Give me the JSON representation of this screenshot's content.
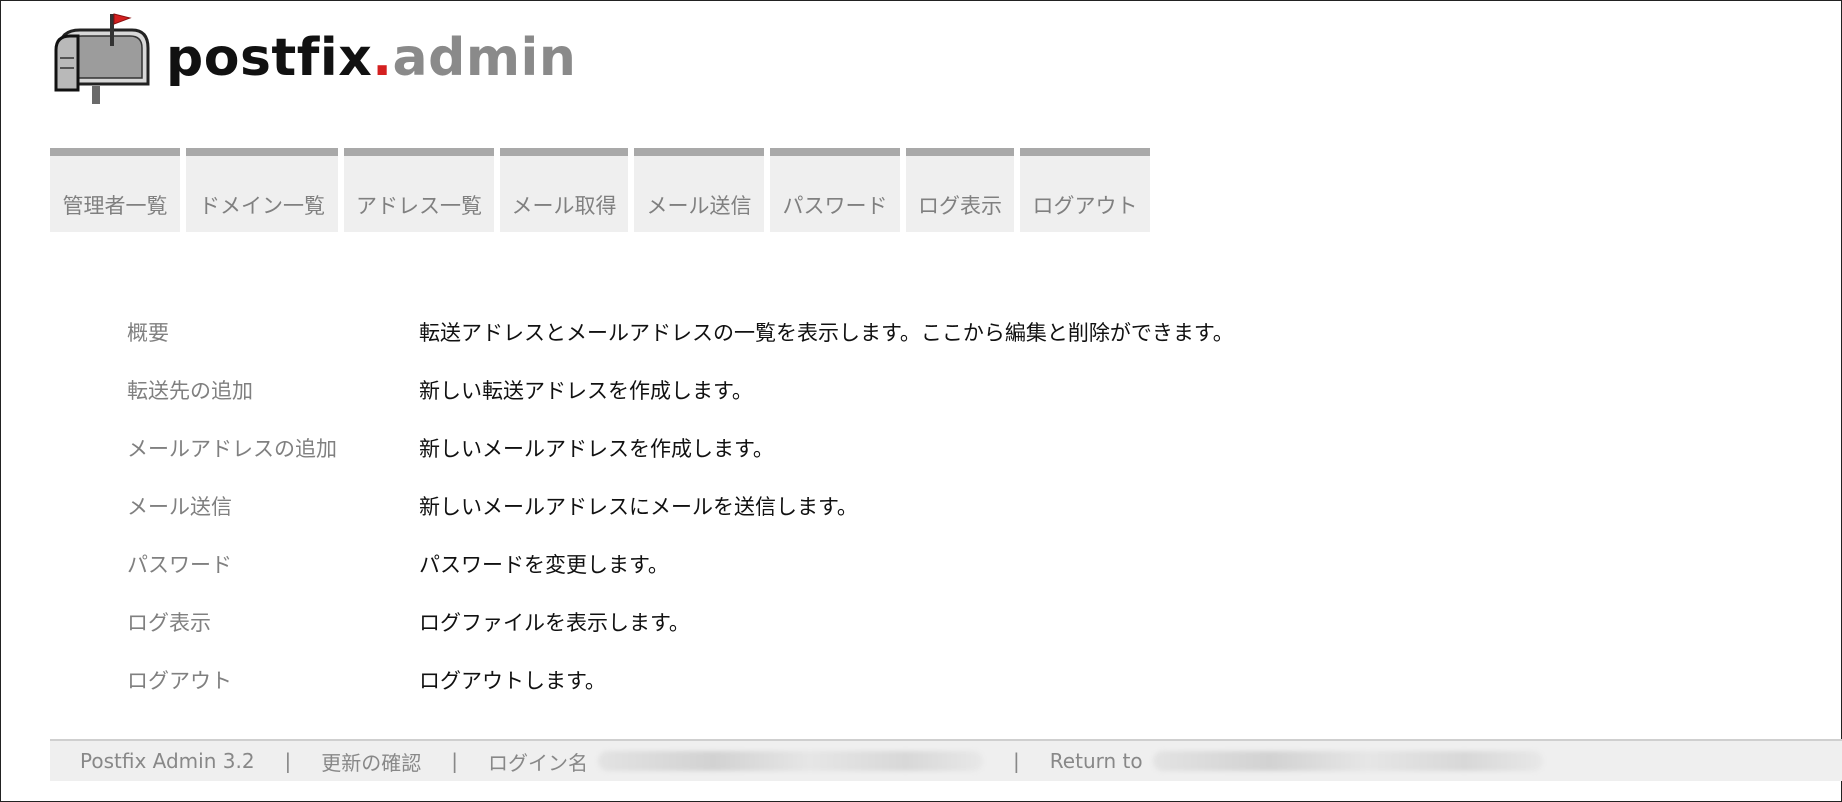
{
  "logo": {
    "word1": "postfix",
    "dot": ".",
    "word2": "admin",
    "icon": "mailbox-icon"
  },
  "nav": [
    {
      "label": "管理者一覧"
    },
    {
      "label": "ドメイン一覧"
    },
    {
      "label": "アドレス一覧"
    },
    {
      "label": "メール取得"
    },
    {
      "label": "メール送信"
    },
    {
      "label": "パスワード"
    },
    {
      "label": "ログ表示"
    },
    {
      "label": "ログアウト"
    }
  ],
  "main": {
    "rows": [
      {
        "label": "概要",
        "desc": "転送アドレスとメールアドレスの一覧を表示します。ここから編集と削除ができます。"
      },
      {
        "label": "転送先の追加",
        "desc": "新しい転送アドレスを作成します。"
      },
      {
        "label": "メールアドレスの追加",
        "desc": "新しいメールアドレスを作成します。"
      },
      {
        "label": "メール送信",
        "desc": "新しいメールアドレスにメールを送信します。"
      },
      {
        "label": "パスワード",
        "desc": "パスワードを変更します。"
      },
      {
        "label": "ログ表示",
        "desc": "ログファイルを表示します。"
      },
      {
        "label": "ログアウト",
        "desc": "ログアウトします。"
      }
    ]
  },
  "footer": {
    "version": "Postfix Admin 3.2",
    "separator": "|",
    "check_updates": "更新の確認",
    "login_label": "ログイン名",
    "return_label": "Return to"
  },
  "colors": {
    "nav_bg": "#efefef",
    "nav_border": "#a9a9a9",
    "label_text": "#808080",
    "logo_dot": "#d42020"
  }
}
